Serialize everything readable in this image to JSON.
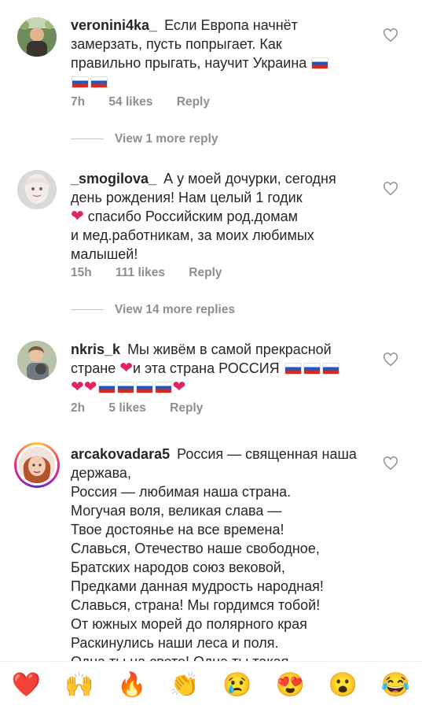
{
  "comments": [
    {
      "username": "veronini4ka_",
      "text_lines": [
        "Если Европа начнёт",
        "замерзать, пусть попрыгает. Как",
        "правильно прыгать,  научит Украина"
      ],
      "time": "7h",
      "likes": "54 likes",
      "reply": "Reply",
      "view_more": "View 1 more reply"
    },
    {
      "username": "_smogilova_",
      "text_lines": [
        "А у моей дочурки, сегодня",
        "день рождения! Нам целый 1 годик",
        "спасибо Российским род.домам",
        "и мед.работникам, за моих любимых",
        "малышей!"
      ],
      "time": "15h",
      "likes": "111 likes",
      "reply": "Reply",
      "view_more": "View 14 more replies"
    },
    {
      "username": "nkris_k",
      "text_lines": [
        "Мы живём в самой прекрасной",
        "стране",
        "и эта страна РОССИЯ"
      ],
      "time": "2h",
      "likes": "5 likes",
      "reply": "Reply"
    },
    {
      "username": "arcakovadara5",
      "text_lines": [
        "Россия — священная наша",
        "держава,",
        "Россия — любимая наша страна.",
        "Могучая воля, великая слава —",
        "Твое достоянье на все времена!",
        "Славься, Отечество наше свободное,",
        "Братских народов союз вековой,",
        "Предками данная мудрость народная!",
        "Славься, страна! Мы гордимся тобой!",
        "От южных морей до полярного края",
        "Раскинулись наши леса и поля.",
        "Одна ты на свете! Одна ты такая —"
      ]
    }
  ],
  "reactions": [
    "❤️",
    "🙌",
    "🔥",
    "👏",
    "😢",
    "😍",
    "😮",
    "😂"
  ],
  "icons": {
    "like": "heart-outline-icon"
  }
}
